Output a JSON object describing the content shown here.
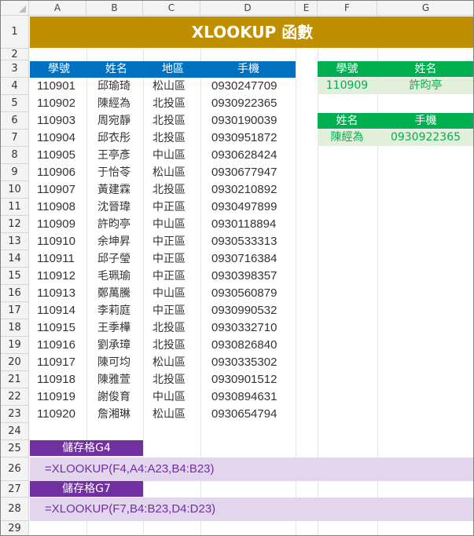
{
  "sheet": {
    "columns": [
      "A",
      "B",
      "C",
      "D",
      "E",
      "F",
      "G"
    ],
    "rows": [
      "1",
      "2",
      "3",
      "4",
      "5",
      "6",
      "7",
      "8",
      "9",
      "10",
      "11",
      "12",
      "13",
      "14",
      "15",
      "16",
      "17",
      "18",
      "19",
      "20",
      "21",
      "22",
      "23",
      "24",
      "25",
      "26",
      "27",
      "28",
      "29"
    ],
    "title": "XLOOKUP 函數",
    "table_headers": [
      "學號",
      "姓名",
      "地區",
      "手機"
    ],
    "table_rows": [
      [
        "110901",
        "邱瑜琦",
        "松山區",
        "0930247709"
      ],
      [
        "110902",
        "陳經為",
        "北投區",
        "0930922365"
      ],
      [
        "110903",
        "周宛靜",
        "北投區",
        "0930190039"
      ],
      [
        "110904",
        "邱衣彤",
        "北投區",
        "0930951872"
      ],
      [
        "110905",
        "王亭彥",
        "中山區",
        "0930628424"
      ],
      [
        "110906",
        "于怡苓",
        "松山區",
        "0930677947"
      ],
      [
        "110907",
        "黃建霖",
        "北投區",
        "0930210892"
      ],
      [
        "110908",
        "沈晉瑋",
        "中正區",
        "0930497899"
      ],
      [
        "110909",
        "許昀亭",
        "中山區",
        "0930118894"
      ],
      [
        "110910",
        "余坤昇",
        "中正區",
        "0930533313"
      ],
      [
        "110911",
        "邱子瑩",
        "中正區",
        "0930716384"
      ],
      [
        "110912",
        "毛珮瑜",
        "中正區",
        "0930398357"
      ],
      [
        "110913",
        "鄭萬騰",
        "中山區",
        "0930560879"
      ],
      [
        "110914",
        "李莉庭",
        "中正區",
        "0930990532"
      ],
      [
        "110915",
        "王季樺",
        "北投區",
        "0930332710"
      ],
      [
        "110916",
        "劉承璋",
        "北投區",
        "0930826840"
      ],
      [
        "110917",
        "陳可均",
        "松山區",
        "0930335302"
      ],
      [
        "110918",
        "陳雅萱",
        "北投區",
        "0930901512"
      ],
      [
        "110919",
        "謝俊育",
        "中山區",
        "0930894631"
      ],
      [
        "110920",
        "詹湘琳",
        "松山區",
        "0930654794"
      ]
    ],
    "lookup1": {
      "header_left": "學號",
      "header_right": "姓名",
      "value_left": "110909",
      "value_right": "許昀亭"
    },
    "lookup2": {
      "header_left": "姓名",
      "header_right": "手機",
      "value_left": "陳經為",
      "value_right": "0930922365"
    },
    "label_g4": "儲存格G4",
    "formula_g4": "=XLOOKUP(F4,A4:A23,B4:B23)",
    "label_g7": "儲存格G7",
    "formula_g7": "=XLOOKUP(F7,B4:B23,D4:D23)"
  },
  "colors": {
    "title_fill": "#bf8f00",
    "table_header_fill": "#0070c0",
    "lookup_header_fill": "#00b050",
    "lookup_value_fill": "#e2efda",
    "lookup_value_text": "#00b050",
    "label_fill": "#7030a0",
    "formula_fill": "#e4d5ef",
    "formula_text": "#7030a0"
  }
}
